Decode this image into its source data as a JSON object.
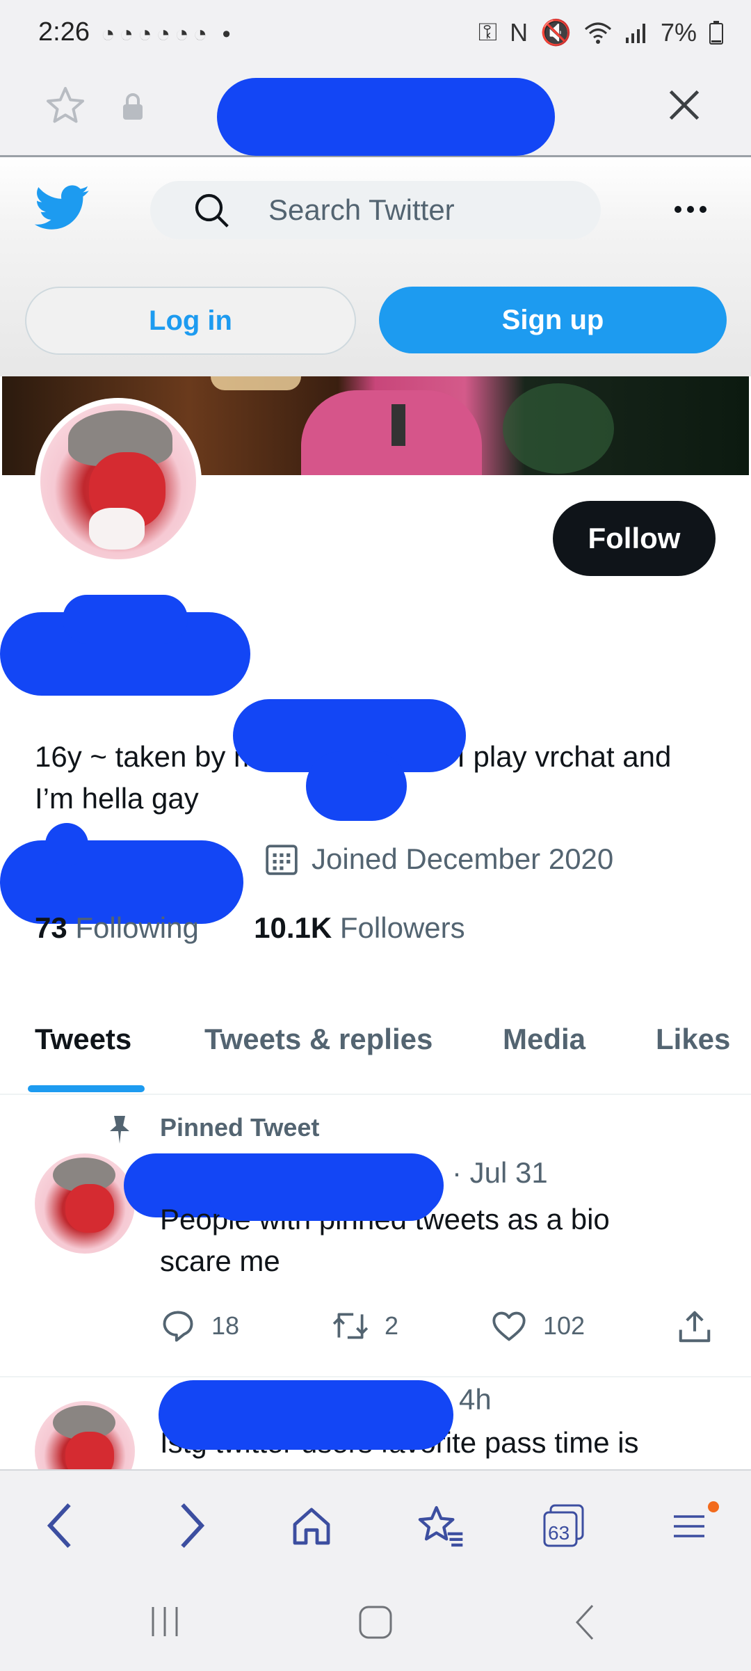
{
  "status_bar": {
    "time": "2:26",
    "battery": "7%"
  },
  "twitter_header": {
    "search_placeholder": "Search Twitter",
    "login_label": "Log in",
    "signup_label": "Sign up"
  },
  "profile": {
    "follow_label": "Follow",
    "bio_line1": "16y ~ taken by m",
    "bio_line1_end": "~ I play vrchat and",
    "bio_line2": "I’m hella gay",
    "joined": "Joined December 2020",
    "following_count": "73",
    "following_label": "Following",
    "followers_count": "10.1K",
    "followers_label": "Followers"
  },
  "tabs": [
    "Tweets",
    "Tweets & replies",
    "Media",
    "Likes"
  ],
  "tweets": [
    {
      "pinned_label": "Pinned Tweet",
      "date": "· Jul 31",
      "text_line1": "People with pinned tweets as a bio",
      "text_line2": "scare me",
      "replies": "18",
      "retweets": "2",
      "likes": "102"
    },
    {
      "date": "4h",
      "text_line1": "Istg twitter users favorite pass time is"
    }
  ],
  "bottom_toolbar": {
    "tabs_count": "63"
  },
  "colors": {
    "twitter_blue": "#1d9bf0",
    "redaction": "#1346f5",
    "follow_bg": "#0f1419"
  }
}
